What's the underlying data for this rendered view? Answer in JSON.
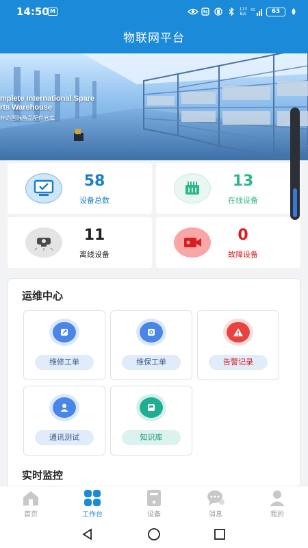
{
  "status_bar": {
    "time": "14:50",
    "badge": "M",
    "network_top": "113",
    "network_bottom": "B/s",
    "network_type": "4G",
    "battery": "63"
  },
  "header": {
    "title": "物联网平台"
  },
  "banner": {
    "line1": "mplete International Spare",
    "line2": "rts Warehouse",
    "subtitle": "杯的国际备品配件仓库"
  },
  "stats": [
    {
      "value": "58",
      "label": "设备总数",
      "value_color": "#1a7fc7",
      "label_color": "#1a7fc7",
      "icon": "monitor-icon"
    },
    {
      "value": "13",
      "label": "在线设备",
      "value_color": "#2eb88a",
      "label_color": "#2eb88a",
      "icon": "chip-icon"
    },
    {
      "value": "11",
      "label": "离线设备",
      "value_color": "#222222",
      "label_color": "#222222",
      "icon": "camera-offline-icon"
    },
    {
      "value": "0",
      "label": "故障设备",
      "value_color": "#d81e1e",
      "label_color": "#d81e1e",
      "icon": "camera-fault-icon"
    }
  ],
  "ops": {
    "title": "运维中心",
    "items": [
      {
        "label": "维修工单",
        "icon": "wrench-icon",
        "color": "#4a86e8"
      },
      {
        "label": "维保工单",
        "icon": "maintenance-icon",
        "color": "#4a86e8"
      },
      {
        "label": "告警记录",
        "icon": "warning-icon",
        "color": "#e9433f"
      },
      {
        "label": "通讯测试",
        "icon": "user-icon",
        "color": "#4a86e8"
      },
      {
        "label": "知识库",
        "icon": "book-icon",
        "color": "#1fae93"
      }
    ]
  },
  "monitor": {
    "title": "实时监控"
  },
  "tabs": [
    {
      "label": "首页",
      "icon": "home-icon"
    },
    {
      "label": "工作台",
      "icon": "workbench-icon"
    },
    {
      "label": "设备",
      "icon": "device-icon"
    },
    {
      "label": "消息",
      "icon": "message-icon"
    },
    {
      "label": "我的",
      "icon": "profile-icon"
    }
  ],
  "active_tab_color": "#1a8ad9",
  "accent": "#1a8ad9"
}
